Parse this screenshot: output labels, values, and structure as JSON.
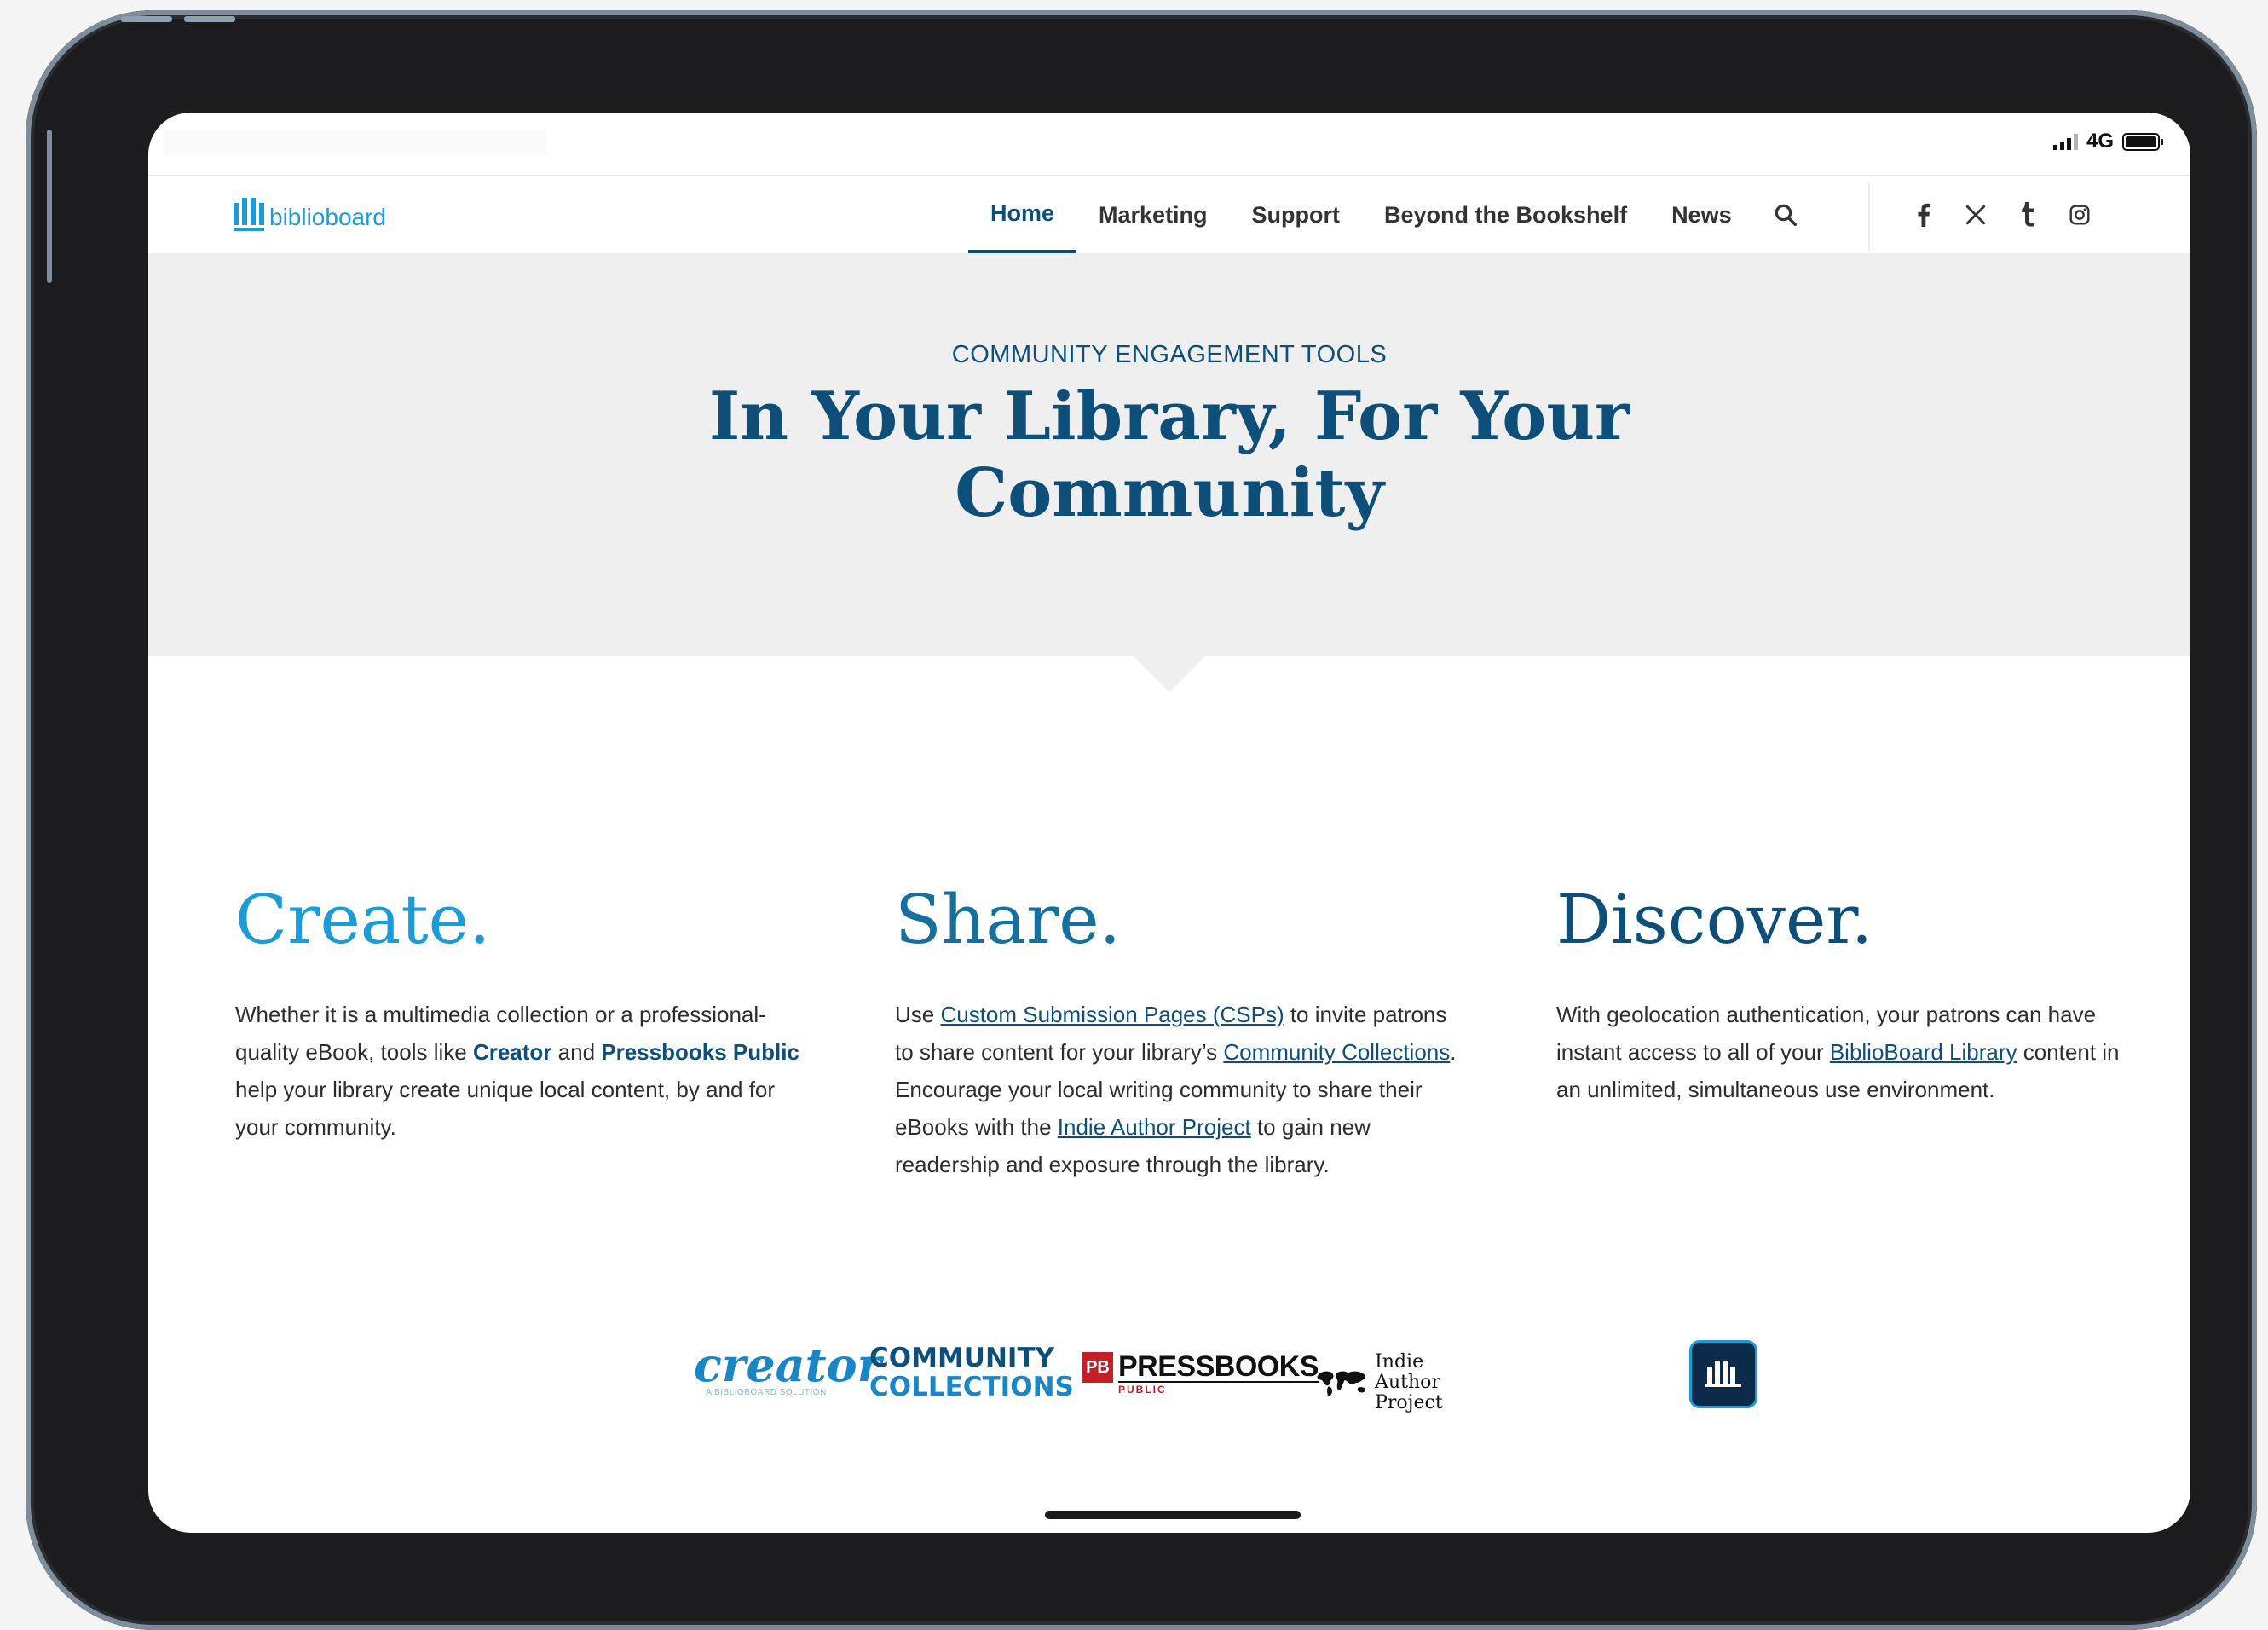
{
  "status": {
    "network": "4G"
  },
  "site": {
    "logo_text": "biblioboard"
  },
  "nav": {
    "items": [
      {
        "label": "Home",
        "active": true
      },
      {
        "label": "Marketing",
        "active": false
      },
      {
        "label": "Support",
        "active": false
      },
      {
        "label": "Beyond the Bookshelf",
        "active": false
      },
      {
        "label": "News",
        "active": false
      }
    ],
    "search_icon": "search-icon",
    "social": [
      "facebook-icon",
      "x-icon",
      "tumblr-icon",
      "instagram-icon"
    ]
  },
  "hero": {
    "eyebrow": "COMMUNITY ENGAGEMENT TOOLS",
    "title_line1": "In Your Library, For Your",
    "title_line2": "Community"
  },
  "columns": {
    "create": {
      "heading": "Create.",
      "p_1": "Whether it is a multimedia collection or a professional-quality eBook, tools like ",
      "creator": "Creator",
      "p_2": " and ",
      "pressbooks": "Pressbooks Public",
      "p_3": " help your library create unique local content, by and for your community."
    },
    "share": {
      "heading": "Share.",
      "p_1": "Use ",
      "link_csp": "Custom Submission Pages (CSPs)",
      "p_2": " to invite patrons to share content for your library’s ",
      "link_cc": "Community Collections",
      "p_3": ". Encourage your local writing community to share their eBooks with the ",
      "link_iap": "Indie Author Project",
      "p_4": " to gain new readership and exposure through the library."
    },
    "discover": {
      "heading": "Discover.",
      "p_1": "With geolocation authentication, your patrons can have instant access to all of your ",
      "link_library": "BiblioBoard Library",
      "p_2": " content in an unlimited, simultaneous use environment."
    }
  },
  "partner_logos": {
    "creator": {
      "word": "creator",
      "tagline": "A BIBLIOBOARD SOLUTION"
    },
    "community_collections": {
      "line1": "COMMUNITY",
      "line2": "COLLECTIONS"
    },
    "pressbooks": {
      "badge": "PB",
      "word": "PRESSBOOKS",
      "sub": "PUBLIC"
    },
    "indie_author": {
      "line1": "Indie Author",
      "line2": "Project"
    },
    "biblioboard_app": "biblioboard-app-icon"
  },
  "colors": {
    "brand_dark": "#0e4f7a",
    "brand_light": "#1b9bd7",
    "share_blue": "#16709f",
    "hero_bg": "#efefef",
    "pressbooks_red": "#c32026"
  }
}
